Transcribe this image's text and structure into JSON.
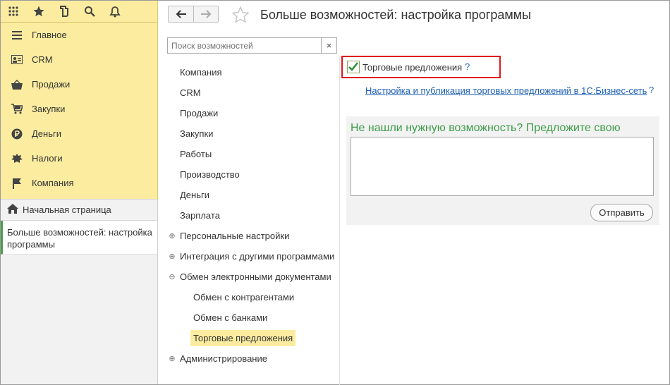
{
  "window": {
    "title": "Больше возможностей: настройка программы"
  },
  "topbar": {
    "icons": [
      "apps-grid-icon",
      "star-icon",
      "history-icon",
      "search-icon",
      "bell-icon"
    ]
  },
  "sidebar": {
    "items": [
      {
        "label": "Главное",
        "icon": "menu-lines-icon"
      },
      {
        "label": "CRM",
        "icon": "contact-card-icon"
      },
      {
        "label": "Продажи",
        "icon": "basket-icon"
      },
      {
        "label": "Закупки",
        "icon": "cart-icon"
      },
      {
        "label": "Деньги",
        "icon": "ruble-coin-icon"
      },
      {
        "label": "Налоги",
        "icon": "emblem-icon"
      },
      {
        "label": "Компания",
        "icon": "flag-icon"
      }
    ]
  },
  "windows": {
    "home_label": "Начальная страница",
    "active_label": "Больше возможностей: настройка программы"
  },
  "search": {
    "placeholder": "Поиск возможностей",
    "clear": "×"
  },
  "categories": [
    {
      "label": "Компания",
      "expander": "",
      "sub": false,
      "selected": false
    },
    {
      "label": "CRM",
      "expander": "",
      "sub": false,
      "selected": false
    },
    {
      "label": "Продажи",
      "expander": "",
      "sub": false,
      "selected": false
    },
    {
      "label": "Закупки",
      "expander": "",
      "sub": false,
      "selected": false
    },
    {
      "label": "Работы",
      "expander": "",
      "sub": false,
      "selected": false
    },
    {
      "label": "Производство",
      "expander": "",
      "sub": false,
      "selected": false
    },
    {
      "label": "Деньги",
      "expander": "",
      "sub": false,
      "selected": false
    },
    {
      "label": "Зарплата",
      "expander": "",
      "sub": false,
      "selected": false
    },
    {
      "label": "Персональные настройки",
      "expander": "⊕",
      "sub": false,
      "selected": false
    },
    {
      "label": "Интеграция с другими программами",
      "expander": "⊕",
      "sub": false,
      "selected": false
    },
    {
      "label": "Обмен электронными документами",
      "expander": "⊖",
      "sub": false,
      "selected": false
    },
    {
      "label": "Обмен с контрагентами",
      "expander": "",
      "sub": true,
      "selected": false
    },
    {
      "label": "Обмен с банками",
      "expander": "",
      "sub": true,
      "selected": false
    },
    {
      "label": "Торговые предложения",
      "expander": "",
      "sub": true,
      "selected": true
    },
    {
      "label": "Администрирование",
      "expander": "⊕",
      "sub": false,
      "selected": false
    }
  ],
  "option": {
    "label": "Торговые предложения",
    "checked": true,
    "help": "?"
  },
  "link": {
    "label": "Настройка и публикация торговых предложений в 1С:Бизнес-сеть",
    "help": "?"
  },
  "suggest": {
    "heading": "Не нашли нужную возможность? Предложите свою",
    "text": "",
    "send_label": "Отправить"
  },
  "colors": {
    "sidebar_bg": "#fbeca0",
    "accent_green": "#3e9e4a",
    "highlight_red": "#e0171d",
    "link_blue": "#1c5fb5"
  }
}
